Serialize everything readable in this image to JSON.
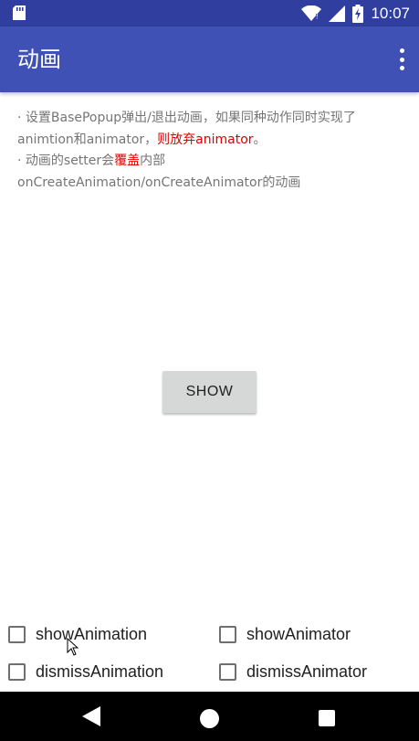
{
  "status_bar": {
    "time": "10:07",
    "icons": [
      "sd-card-icon",
      "wifi-icon",
      "signal-icon",
      "battery-charging-icon"
    ]
  },
  "app_bar": {
    "title": "动画",
    "menu_icon": "overflow-menu-icon"
  },
  "description": {
    "line1_prefix": "· 设置BasePopup弹出/退出动画，如果同种动作同时实现了animtion和animator，",
    "line1_highlight": "则放弃animator",
    "line1_suffix": "。",
    "line2_prefix": "· 动画的setter会",
    "line2_highlight": "覆盖",
    "line2_suffix": "内部onCreateAnimation/onCreateAnimator的动画"
  },
  "show_button": {
    "label": "SHOW"
  },
  "checkboxes": [
    {
      "label": "showAnimation",
      "checked": false
    },
    {
      "label": "showAnimator",
      "checked": false
    },
    {
      "label": "dismissAnimation",
      "checked": false
    },
    {
      "label": "dismissAnimator",
      "checked": false
    }
  ],
  "nav_bar": {
    "icons": [
      "back-icon",
      "home-icon",
      "recents-icon"
    ]
  },
  "colors": {
    "status_bar": "#303f9f",
    "app_bar": "#3f51b5",
    "highlight": "#e00000",
    "body_text": "#757575"
  }
}
